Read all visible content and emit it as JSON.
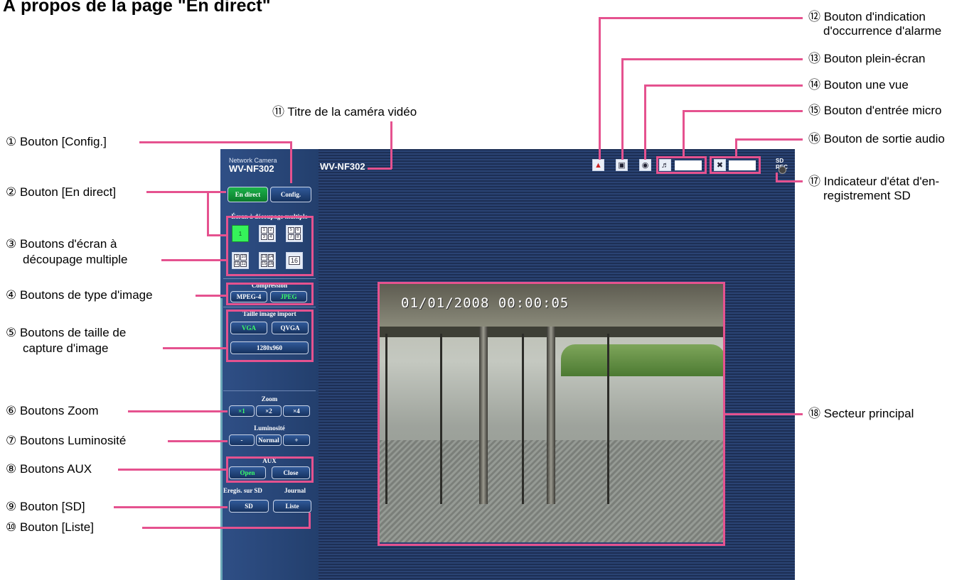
{
  "page_title": "À propos de la page \"En direct\"",
  "camera": {
    "brand_small": "Network Camera",
    "model": "WV-NF302",
    "title": "WV-NF302",
    "sd_rec_label": "SD REC",
    "timestamp": "01/01/2008 00:00:05"
  },
  "sidebar": {
    "live_button": "En direct",
    "config_button": "Config.",
    "multiscreen_header": "Écran à découpage multiple",
    "split_buttons": [
      {
        "label": "1"
      },
      {
        "cells": [
          "1",
          "2",
          "3",
          "4"
        ]
      },
      {
        "cells": [
          "5",
          "6",
          "7",
          "8"
        ]
      },
      {
        "cells": [
          "9",
          "10",
          "11",
          "12"
        ]
      },
      {
        "cells": [
          "13",
          "14",
          "15",
          "16"
        ]
      },
      {
        "label": "16"
      }
    ],
    "compression_header": "Compression",
    "mpeg4_button": "MPEG-4",
    "jpeg_button": "JPEG",
    "capture_size_header": "Taille image import",
    "vga_button": "VGA",
    "qvga_button": "QVGA",
    "size_1280_button": "1280x960",
    "zoom_header": "Zoom",
    "zoom_x1": "×1",
    "zoom_x2": "×2",
    "zoom_x4": "×4",
    "brightness_header": "Luminosité",
    "brightness_minus": "-",
    "brightness_normal": "Normal",
    "brightness_plus": "+",
    "aux_header": "AUX",
    "aux_open": "Open",
    "aux_close": "Close",
    "sd_record_header": "Eregis. sur SD",
    "journal_header": "Journal",
    "sd_button": "SD",
    "list_button": "Liste"
  },
  "callouts": {
    "c1": "① Bouton [Config.]",
    "c2": "② Bouton [En direct]",
    "c3a": "③ Boutons d'écran à",
    "c3b": "découpage multiple",
    "c4": "④ Boutons de type d'image",
    "c5a": "⑤ Boutons de taille de",
    "c5b": "capture d'image",
    "c6": "⑥ Boutons Zoom",
    "c7": "⑦ Boutons Luminosité",
    "c8": "⑧ Boutons AUX",
    "c9": "⑨ Bouton [SD]",
    "c10": "⑩ Bouton [Liste]",
    "c11": "⑪ Titre de la caméra vidéo",
    "c12a": "⑫ Bouton d'indication",
    "c12b": "d'occurrence d'alarme",
    "c13": "⑬ Bouton plein-écran",
    "c14": "⑭ Bouton une vue",
    "c15": "⑮ Bouton d'entrée micro",
    "c16": "⑯ Bouton de sortie audio",
    "c17a": "⑰ Indicateur d'état d'en-",
    "c17b": "registrement SD",
    "c18": "⑱ Secteur principal"
  },
  "colors": {
    "callout_line": "#e5528f",
    "sidebar_bg": "#2f4f86",
    "active_green": "#1bb24a"
  }
}
